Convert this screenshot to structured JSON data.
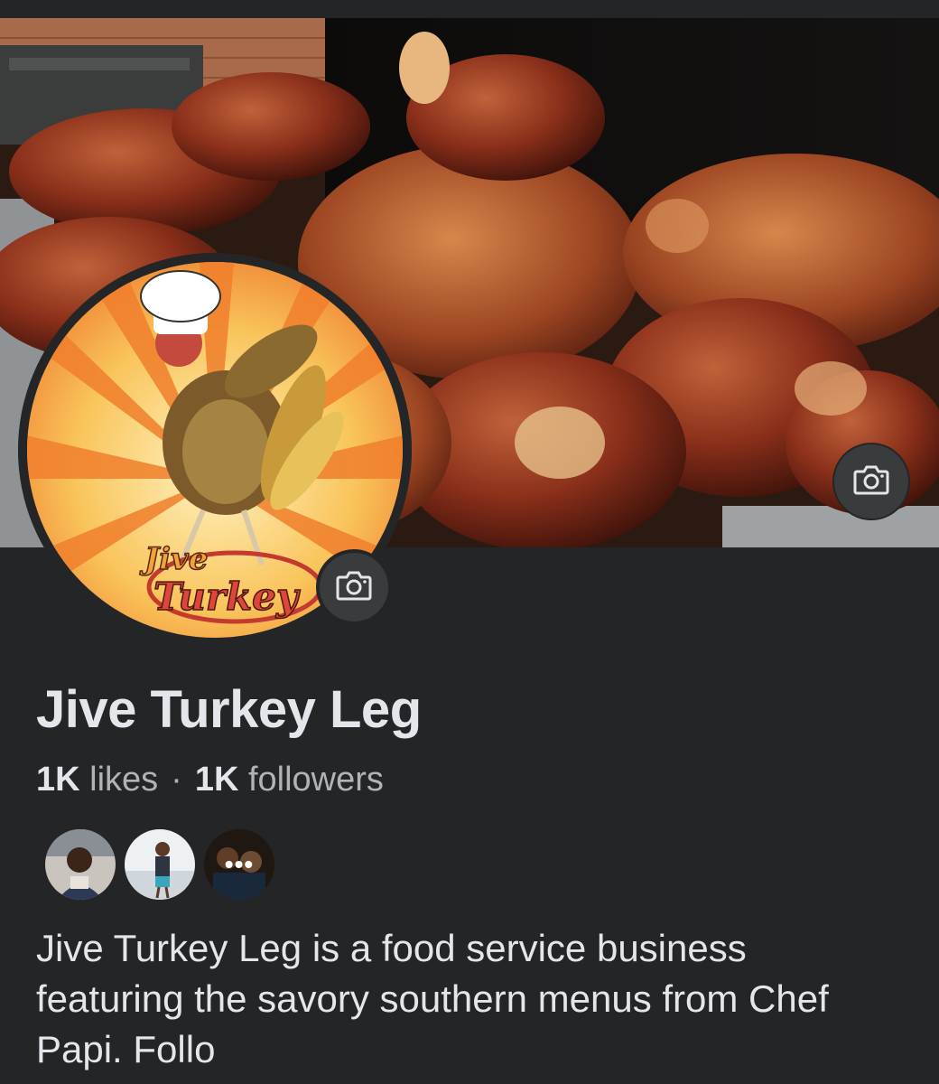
{
  "page": {
    "name": "Jive Turkey Leg",
    "likes_count": "1K",
    "likes_label": "likes",
    "separator": "·",
    "followers_count": "1K",
    "followers_label": "followers",
    "bio": "Jive Turkey Leg is a food service business featuring the savory southern menus from Chef Papi. Follo"
  },
  "logo": {
    "line1": "Jive",
    "line2": "Turkey"
  },
  "friends_preview": {
    "more_glyph": "•••"
  },
  "icons": {
    "cover_camera": "camera-icon",
    "profile_camera": "camera-icon"
  },
  "colors": {
    "background": "#242526",
    "button_bg": "#3a3b3c",
    "text_primary": "#e4e6eb",
    "text_secondary": "#b0b3b8"
  }
}
